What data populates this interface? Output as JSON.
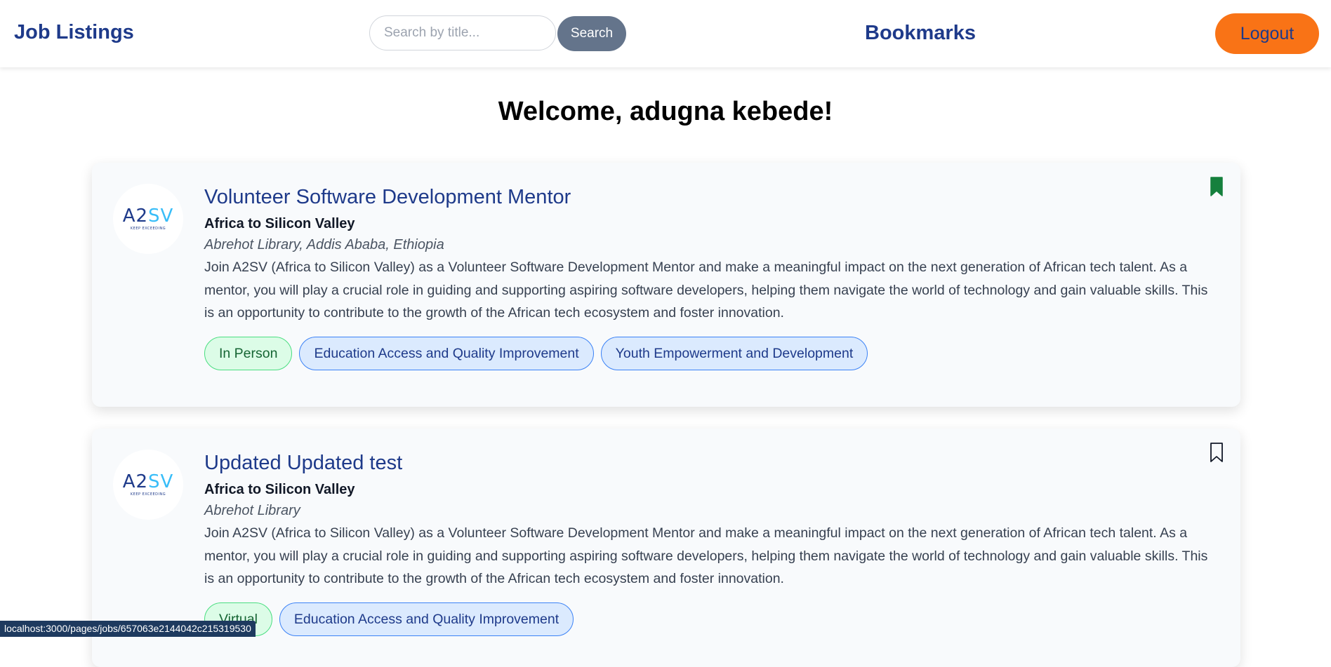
{
  "header": {
    "brand": "Job Listings",
    "search_placeholder": "Search by title...",
    "search_button": "Search",
    "bookmarks_link": "Bookmarks",
    "logout_button": "Logout"
  },
  "welcome": "Welcome, adugna kebede!",
  "logo": {
    "main_a": "A2",
    "main_b": "SV",
    "tagline": "KEEP EXCEEDING"
  },
  "jobs": [
    {
      "title": "Volunteer Software Development Mentor",
      "company": "Africa to Silicon Valley",
      "location": "Abrehot Library, Addis Ababa, Ethiopia",
      "description": "Join A2SV (Africa to Silicon Valley) as a Volunteer Software Development Mentor and make a meaningful impact on the next generation of African tech talent. As a mentor, you will play a crucial role in guiding and supporting aspiring software developers, helping them navigate the world of technology and gain valuable skills. This is an opportunity to contribute to the growth of the African tech ecosystem and foster innovation.",
      "tags": [
        "In Person",
        "Education Access and Quality Improvement",
        "Youth Empowerment and Development"
      ],
      "bookmarked": true,
      "bookmark_icon": "bookmark-filled-icon"
    },
    {
      "title": "Updated Updated test",
      "company": "Africa to Silicon Valley",
      "location": "Abrehot Library",
      "description": "Join A2SV (Africa to Silicon Valley) as a Volunteer Software Development Mentor and make a meaningful impact on the next generation of African tech talent. As a mentor, you will play a crucial role in guiding and supporting aspiring software developers, helping them navigate the world of technology and gain valuable skills. This is an opportunity to contribute to the growth of the African tech ecosystem and foster innovation.",
      "tags": [
        "Virtual",
        "Education Access and Quality Improvement"
      ],
      "bookmarked": false,
      "bookmark_icon": "bookmark-outline-icon"
    }
  ],
  "status_bar": {
    "url": "localhost:3000/pages/jobs/657063e2144042c215319530"
  },
  "colors": {
    "brand_blue": "#1e3a8a",
    "logout_orange": "#f97316",
    "search_button": "#64748b",
    "bookmark_filled": "#15803d",
    "tag_green_bg": "#dcfce7",
    "tag_blue_bg": "#dbeafe"
  }
}
